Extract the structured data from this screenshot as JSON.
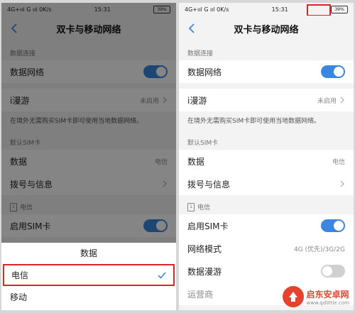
{
  "left": {
    "status": {
      "signal": "4G+ııl G ııl 0K/s",
      "time": "15:31",
      "battery": "39%"
    },
    "title": "双卡与移动网络",
    "section_data": "数据连接",
    "data_network": "数据网络",
    "roaming": {
      "label": "i漫游",
      "value": "未启用"
    },
    "hint": "在境外无需购买SIM卡即可使用当地数据网络。",
    "default_sim": "默认SIM卡",
    "data": {
      "label": "数据",
      "value": "电信"
    },
    "dial": "拨号与信息",
    "sim_section": "电信",
    "sim_num": "1",
    "enable_sim": "启用SIM卡",
    "sheet": {
      "title": "数据",
      "options": [
        {
          "label": "电信",
          "selected": true
        },
        {
          "label": "移动",
          "selected": false
        }
      ]
    }
  },
  "right": {
    "status": {
      "signal": "4G+ııl G ııl 0K/s",
      "time": "15:31",
      "battery": "39%"
    },
    "title": "双卡与移动网络",
    "section_data": "数据连接",
    "data_network": "数据网络",
    "roaming": {
      "label": "i漫游",
      "value": "未启用"
    },
    "hint": "在境外无需购买SIM卡即可使用当地数据网络。",
    "default_sim": "默认SIM卡",
    "data": {
      "label": "数据",
      "value": "电信"
    },
    "dial": "拨号与信息",
    "sim_section": "电信",
    "sim_num": "1",
    "enable_sim": "启用SIM卡",
    "network_mode": {
      "label": "网络模式",
      "value": "4G (优先)/3G/2G"
    },
    "data_roaming": "数据漫游",
    "carrier": "运营商"
  },
  "watermark": {
    "name": "启东安卓网",
    "url": "www.qdlittle.com"
  },
  "colors": {
    "accent": "#3b87e0",
    "highlight": "#d8262a"
  }
}
